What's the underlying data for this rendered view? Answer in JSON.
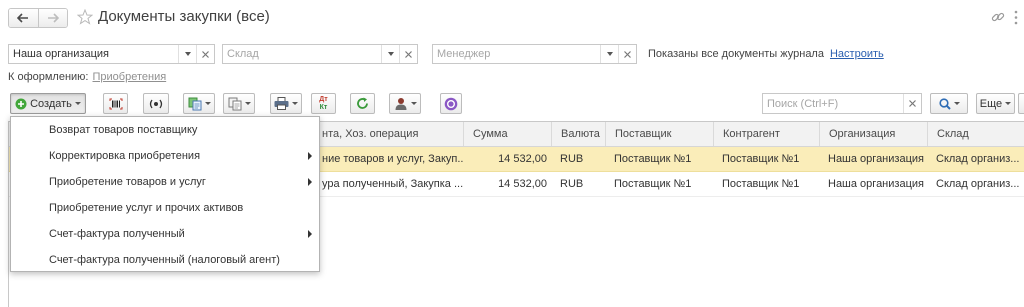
{
  "window": {
    "title": "Документы закупки (все)"
  },
  "filters": {
    "organization": {
      "value": "Наша организация"
    },
    "warehouse": {
      "placeholder": "Склад"
    },
    "manager": {
      "placeholder": "Менеджер"
    },
    "info_text": "Показаны все документы журнала",
    "configure_link": "Настроить"
  },
  "to_process": {
    "label": "К оформлению:",
    "link": "Приобретения"
  },
  "toolbar": {
    "create_label": "Создать",
    "dt_kt": {
      "top": "Дт",
      "bottom": "Кт"
    },
    "search_placeholder": "Поиск (Ctrl+F)",
    "more_label": "Еще",
    "icons": [
      "plus-circle-icon",
      "barcode-icon",
      "radio-signal-icon",
      "copy-documents-icon",
      "documents-icon",
      "printer-icon",
      "debit-credit-icon",
      "refresh-icon",
      "person-stamp-icon",
      "discussion-icon",
      "search-icon"
    ]
  },
  "table": {
    "columns": [
      "нта, Хоз. операция",
      "Сумма",
      "Валюта",
      "Поставщик",
      "Контрагент",
      "Организация",
      "Склад"
    ],
    "rows": [
      [
        "ние товаров и услуг, Закуп...",
        "14 532,00",
        "RUB",
        "Поставщик №1",
        "Поставщик №1",
        "Наша организация",
        "Склад организ..."
      ],
      [
        "ура полученный, Закупка ...",
        "14 532,00",
        "RUB",
        "Поставщик №1",
        "Поставщик №1",
        "Наша организация",
        "Склад организ..."
      ]
    ],
    "selected_row_index": 0
  },
  "create_menu": {
    "items": [
      {
        "label": "Возврат товаров поставщику",
        "has_submenu": false
      },
      {
        "label": "Корректировка приобретения",
        "has_submenu": true
      },
      {
        "label": "Приобретение товаров и услуг",
        "has_submenu": true
      },
      {
        "label": "Приобретение услуг и прочих активов",
        "has_submenu": false
      },
      {
        "label": "Счет-фактура полученный",
        "has_submenu": true
      },
      {
        "label": "Счет-фактура полученный (налоговый агент)",
        "has_submenu": false
      }
    ]
  },
  "colors": {
    "link": "#2a5fb0",
    "muted_link": "#909090",
    "selected_row": "#faedb9",
    "create_icon": "#42a73a",
    "refresh_icon": "#3a9a3a",
    "discussion_icon": "#8b58c5"
  }
}
